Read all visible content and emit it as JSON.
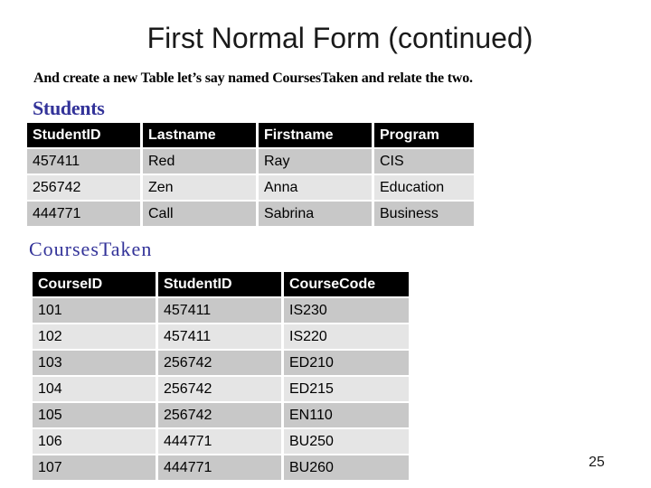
{
  "slide": {
    "title": "First Normal Form (continued)",
    "subtitle": "And create a new Table let’s say named CoursesTaken and relate the two.",
    "page_number": "25"
  },
  "students": {
    "label": "Students",
    "columns": [
      "StudentID",
      "Lastname",
      "Firstname",
      "Program"
    ],
    "rows": [
      [
        "457411",
        "Red",
        "Ray",
        "CIS"
      ],
      [
        "256742",
        "Zen",
        "Anna",
        "Education"
      ],
      [
        "444771",
        "Call",
        "Sabrina",
        "Business"
      ]
    ]
  },
  "courses_taken": {
    "label": "CoursesTaken",
    "columns": [
      "CourseID",
      "StudentID",
      "CourseCode"
    ],
    "rows": [
      [
        "101",
        "457411",
        "IS230"
      ],
      [
        "102",
        "457411",
        "IS220"
      ],
      [
        "103",
        "256742",
        "ED210"
      ],
      [
        "104",
        "256742",
        "ED215"
      ],
      [
        "105",
        "256742",
        "EN110"
      ],
      [
        "106",
        "444771",
        "BU250"
      ],
      [
        "107",
        "444771",
        "BU260"
      ]
    ]
  },
  "colors": {
    "header_bg": "#000000",
    "header_text": "#ffffff",
    "row_odd_bg": "#c8c8c8",
    "row_even_bg": "#e5e5e5",
    "section_label": "#333399"
  }
}
